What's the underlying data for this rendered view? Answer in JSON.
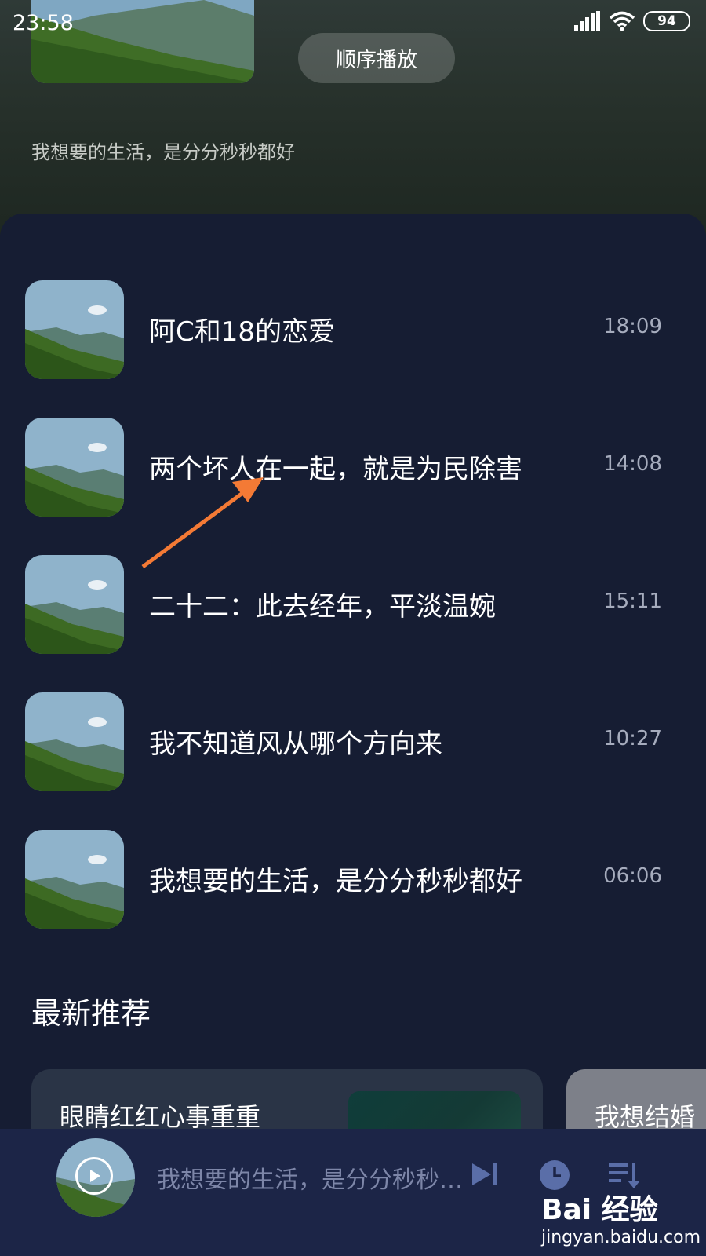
{
  "status_bar": {
    "time": "23:58",
    "battery": "94"
  },
  "header": {
    "order_button": "顺序播放",
    "description": "我想要的生活，是分分秒秒都好"
  },
  "tracks": [
    {
      "title": "阿C和18的恋爱",
      "duration": "18:09"
    },
    {
      "title": "两个坏人在一起，就是为民除害",
      "duration": "14:08"
    },
    {
      "title": "二十二：此去经年，平淡温婉",
      "duration": "15:11"
    },
    {
      "title": "我不知道风从哪个方向来",
      "duration": "10:27"
    },
    {
      "title": "我想要的生活，是分分秒秒都好",
      "duration": "06:06"
    }
  ],
  "recommend": {
    "section_title": "最新推荐",
    "cards": [
      {
        "title": "眼睛红红心事重重"
      },
      {
        "title": "我想结婚"
      }
    ]
  },
  "player": {
    "current_title": "我想要的生活，是分分秒秒都好"
  },
  "watermark": {
    "logo": "Bai 经验",
    "url": "jingyan.baidu.com"
  },
  "colors": {
    "panel": "#161d33",
    "player_bar": "#1c2547",
    "accent_icon": "#5a6ea8",
    "arrow": "#f47a35"
  },
  "icons": [
    "signal-icon",
    "wifi-icon",
    "battery-icon",
    "play-icon",
    "next-track-icon",
    "timer-icon",
    "playlist-icon"
  ]
}
